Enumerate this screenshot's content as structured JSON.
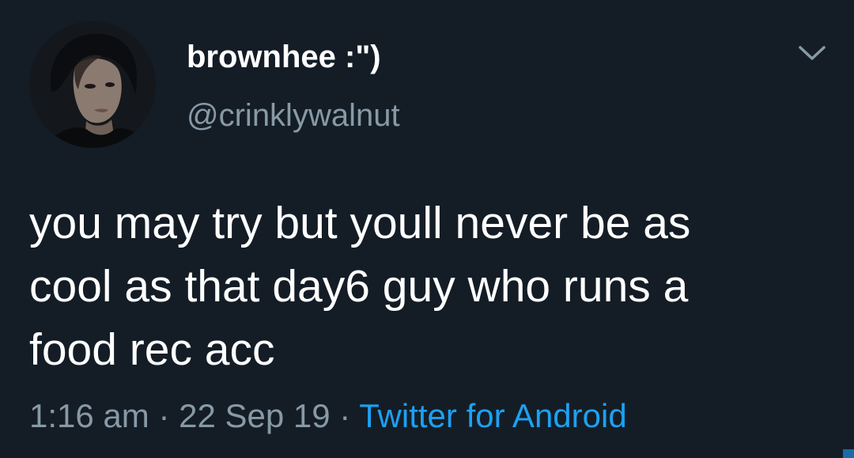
{
  "tweet": {
    "author": {
      "display_name": "brownhee :\")",
      "handle": "@crinklywalnut"
    },
    "text_lines": [
      "you may try but youll never be as",
      "cool as that day6 guy who runs a",
      "food rec acc"
    ],
    "meta": {
      "time": "1:16 am",
      "separator": "·",
      "date": "22 Sep 19",
      "source": "Twitter for Android"
    },
    "icons": {
      "avatar": "avatar-photo",
      "menu": "chevron-down-icon"
    },
    "colors": {
      "background": "#141d26",
      "primary_text": "#ffffff",
      "secondary_text": "#8899a6",
      "link": "#1da1f2"
    }
  }
}
